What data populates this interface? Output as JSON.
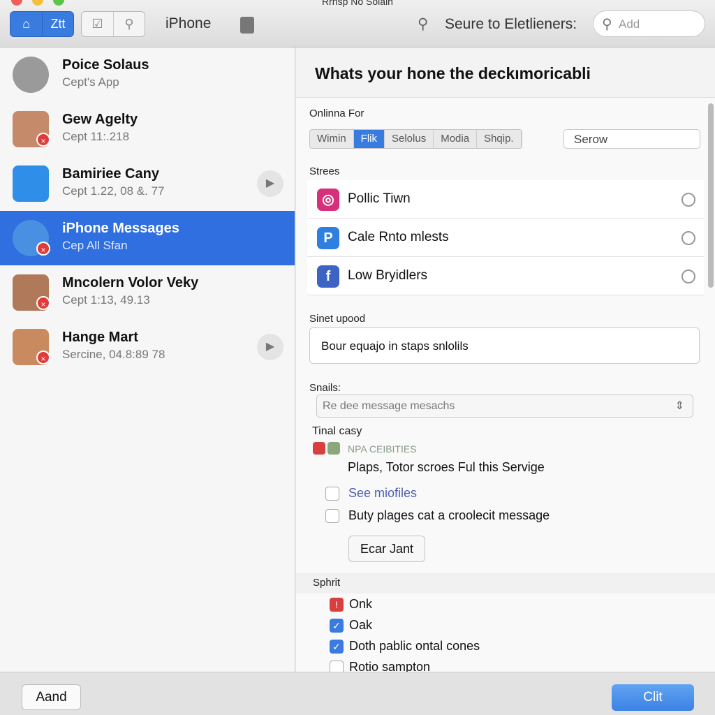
{
  "window": {
    "title": "Rrnsp No Solain"
  },
  "toolbar": {
    "seg1": [
      "Ztt"
    ],
    "device": "iPhone",
    "search_label": "Seure to Eletlieners:",
    "add_placeholder": "Add"
  },
  "sidebar": {
    "items": [
      {
        "name": "Poice Solaus",
        "sub": "Cept's App",
        "selected": false,
        "badge": false,
        "play": false,
        "color": "#9a9a9a"
      },
      {
        "name": "Gew Agelty",
        "sub": "Cept 11:.218",
        "selected": false,
        "badge": true,
        "play": false,
        "color": "#c58a6a"
      },
      {
        "name": "Bamiriee Cany",
        "sub": "Cept 1.22, 08 &. 77",
        "selected": false,
        "badge": false,
        "play": true,
        "color": "#2f8fe8"
      },
      {
        "name": "iPhone Messages",
        "sub": "Cep All Sfan",
        "selected": true,
        "badge": true,
        "play": false,
        "color": "#4a90e2"
      },
      {
        "name": "Mncolern Volor Veky",
        "sub": "Cept 1:13, 49.13",
        "selected": false,
        "badge": true,
        "play": false,
        "color": "#b07a5a"
      },
      {
        "name": "Hange Mart",
        "sub": "Sercine, 04.8:89 78",
        "selected": false,
        "badge": true,
        "play": true,
        "color": "#c98a60"
      }
    ]
  },
  "main": {
    "heading": "Whats your hone the deckımoricabli",
    "online_label": "Onlinna For",
    "tabs": [
      {
        "label": "Wimin",
        "active": false
      },
      {
        "label": "Flik",
        "active": true
      },
      {
        "label": "Selolus",
        "active": false
      },
      {
        "label": "Modia",
        "active": false
      },
      {
        "label": "Shqip.",
        "active": false
      }
    ],
    "search_value": "Serow",
    "streams_label": "Strees",
    "streams": [
      {
        "label": "Pollic Tiwn",
        "icon": "instagram-icon",
        "color": "#d6307a"
      },
      {
        "label": "Cale Rnto mlests",
        "icon": "p-app-icon",
        "color": "#2e7fe0"
      },
      {
        "label": "Low Bryidlers",
        "icon": "facebook-icon",
        "color": "#3b64c4"
      }
    ],
    "sinet_label": "Sinet upood",
    "sinet_value": "Bour equajo in staps snlolils",
    "snails_label": "Snails:",
    "snails_placeholder": "Re dee message mesachs",
    "tinal_label": "Tinal casy",
    "npa_label": "NPA CEIBITIES",
    "plaps_text": "Plaps, Totor scroes Ful this Servige",
    "checks": [
      {
        "label": "See miofiles",
        "checked": false,
        "link": true
      },
      {
        "label": "Buty plages cat a croolecit message",
        "checked": false,
        "link": false
      }
    ],
    "ecar_button": "Ecar Jant",
    "sphrit_label": "Sphrit",
    "options": [
      {
        "label": "Onk",
        "state": "red"
      },
      {
        "label": "Oak",
        "state": "checked"
      },
      {
        "label": "Doth pablic ontal cones",
        "state": "checked"
      },
      {
        "label": "Rotio sampton",
        "state": "unchecked"
      }
    ]
  },
  "footer": {
    "left_button": "Aand",
    "right_button": "Clit"
  },
  "colors": {
    "accent": "#2f6fe0",
    "primary_button": "#4a92ea"
  }
}
